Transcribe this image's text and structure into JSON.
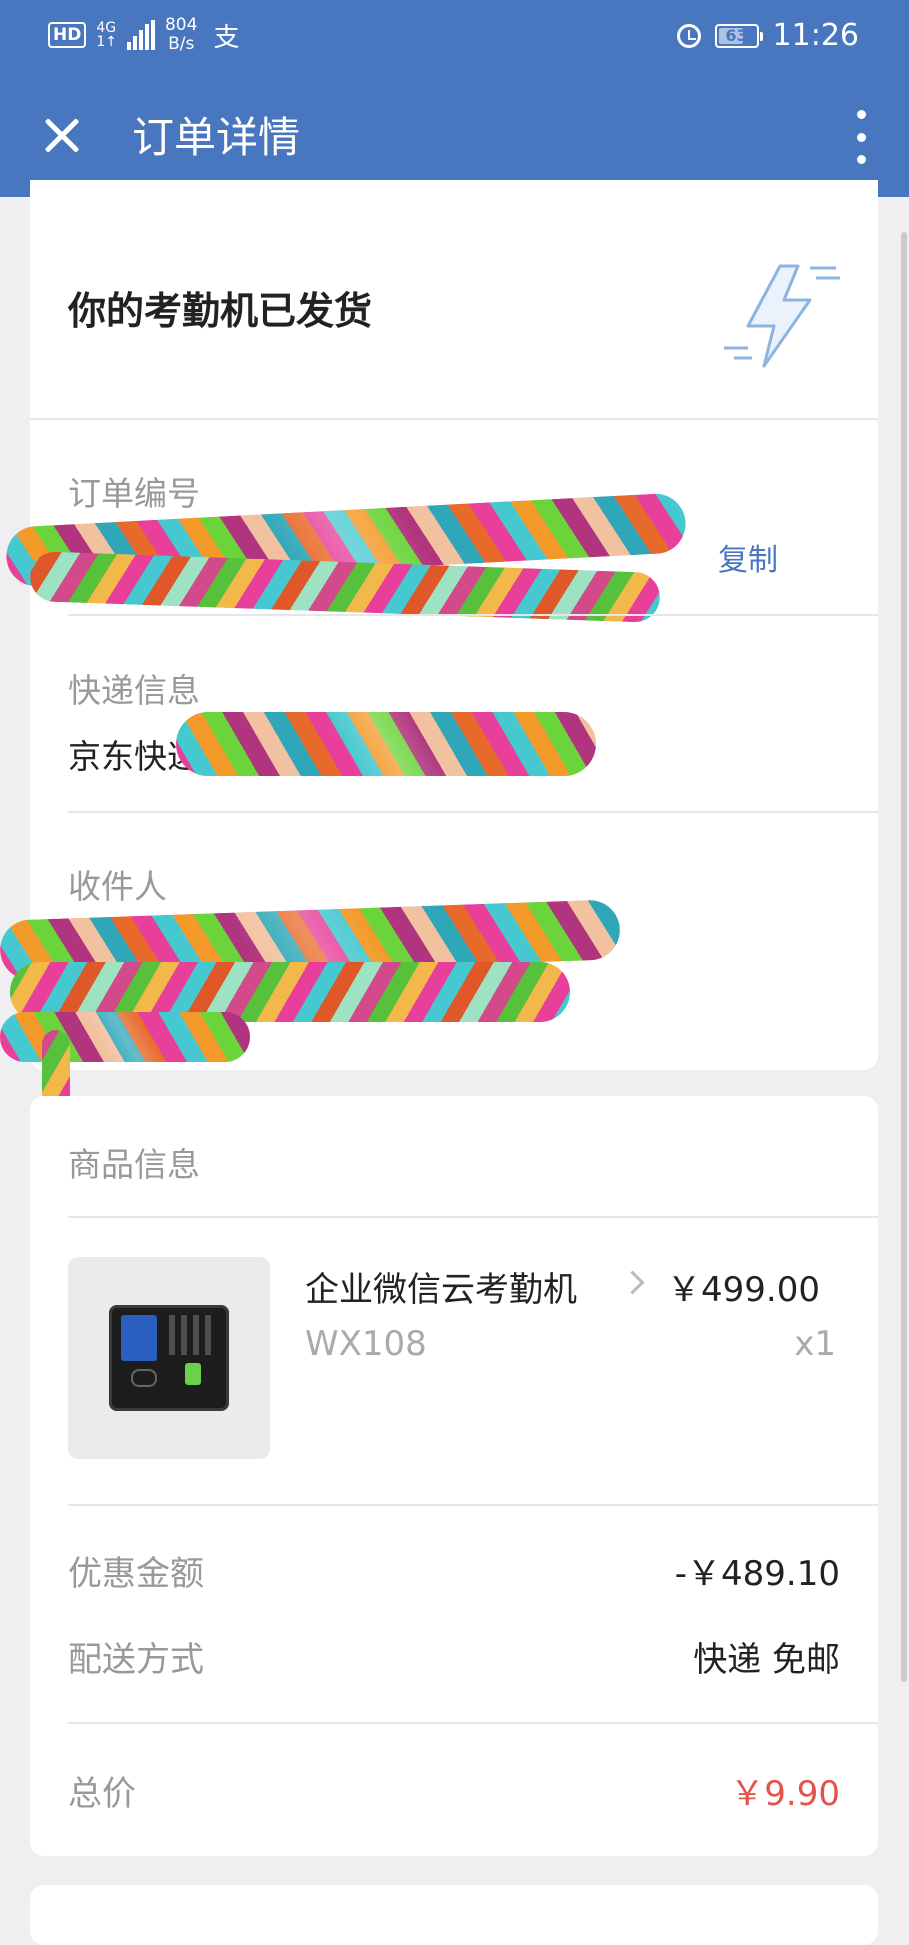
{
  "status_bar": {
    "hd": "HD",
    "network": "4G",
    "network_sub": "1↑",
    "speed_value": "804",
    "speed_unit": "B/s",
    "pay_glyph": "支",
    "battery": "63",
    "time": "11:26"
  },
  "app_bar": {
    "title": "订单详情",
    "close_icon": "close-icon",
    "more_icon": "more-vertical-icon"
  },
  "shipment": {
    "title": "你的考勤机已发货",
    "icon": "lightning-icon"
  },
  "order": {
    "number_label": "订单编号",
    "copy_label": "复制"
  },
  "express": {
    "label": "快递信息",
    "value": "京东快递"
  },
  "recipient": {
    "label": "收件人"
  },
  "product": {
    "section_label": "商品信息",
    "name": "企业微信云考勤机",
    "model": "WX108",
    "price": "￥499.00",
    "quantity": "x1"
  },
  "summary": {
    "discount_label": "优惠金额",
    "discount_value": "-￥489.10",
    "shipping_label": "配送方式",
    "shipping_value": "快递 免邮",
    "total_label": "总价",
    "total_value": "￥9.90",
    "total_color": "#e4534a"
  },
  "colors": {
    "header": "#4877c0",
    "background": "#efeff1"
  }
}
